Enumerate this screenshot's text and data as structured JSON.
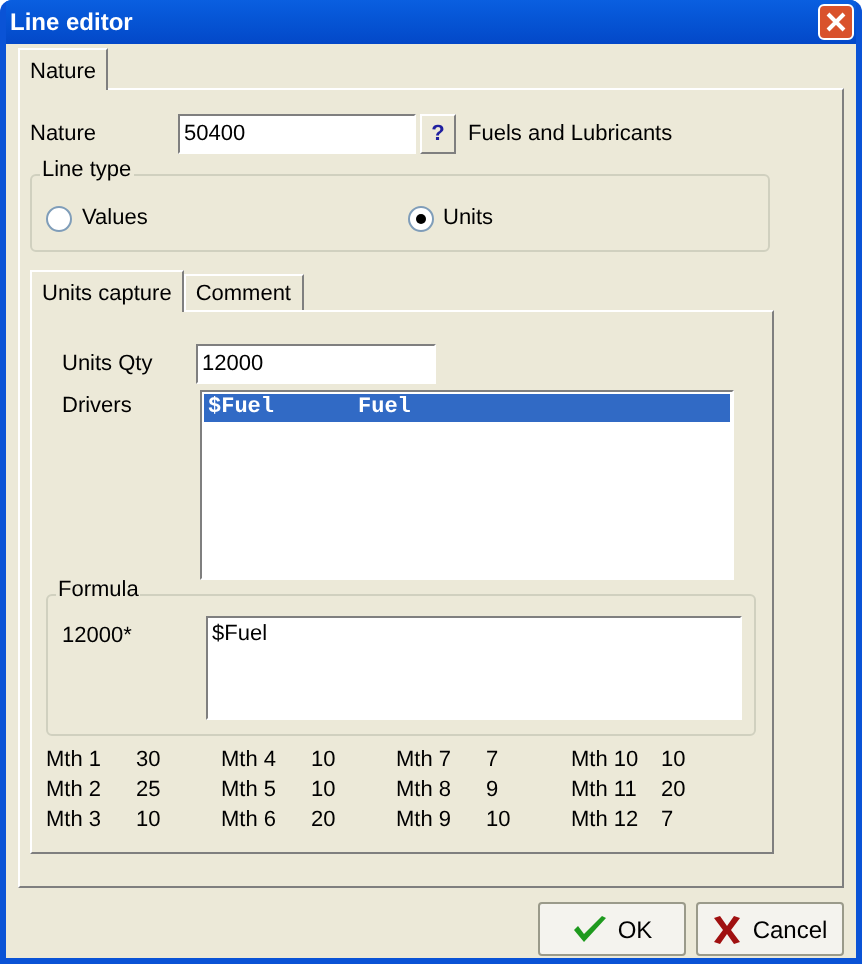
{
  "window": {
    "title": "Line editor"
  },
  "outer_tabs": [
    {
      "label": "Nature",
      "selected": true
    }
  ],
  "nature": {
    "label": "Nature",
    "value": "50400",
    "lookup_button": "?",
    "description": "Fuels and Lubricants"
  },
  "line_type": {
    "title": "Line type",
    "options": [
      {
        "label": "Values",
        "selected": false
      },
      {
        "label": "Units",
        "selected": true
      }
    ]
  },
  "inner_tabs": [
    {
      "label": "Units capture",
      "selected": true
    },
    {
      "label": "Comment",
      "selected": false
    }
  ],
  "units_qty": {
    "label": "Units Qty",
    "value": "12000"
  },
  "drivers": {
    "label": "Drivers",
    "items": [
      {
        "code": "$Fuel",
        "name": "Fuel",
        "selected": true
      }
    ]
  },
  "formula": {
    "title": "Formula",
    "prefix": "12000*",
    "value": "$Fuel"
  },
  "months": [
    [
      {
        "label": "Mth 1",
        "value": "30"
      },
      {
        "label": "Mth 2",
        "value": "25"
      },
      {
        "label": "Mth 3",
        "value": "10"
      }
    ],
    [
      {
        "label": "Mth 4",
        "value": "10"
      },
      {
        "label": "Mth 5",
        "value": "10"
      },
      {
        "label": "Mth 6",
        "value": "20"
      }
    ],
    [
      {
        "label": "Mth 7",
        "value": "7"
      },
      {
        "label": "Mth 8",
        "value": "9"
      },
      {
        "label": "Mth 9",
        "value": "10"
      }
    ],
    [
      {
        "label": "Mth 10",
        "value": "10"
      },
      {
        "label": "Mth 11",
        "value": "20"
      },
      {
        "label": "Mth 12",
        "value": "7"
      }
    ]
  ],
  "buttons": [
    {
      "label": "OK",
      "kind": "ok"
    },
    {
      "label": "Cancel",
      "kind": "cancel"
    }
  ]
}
